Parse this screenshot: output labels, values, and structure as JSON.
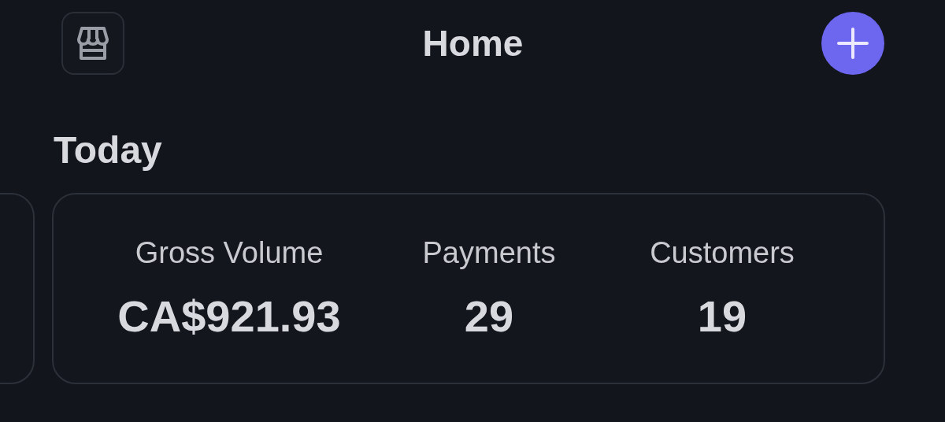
{
  "header": {
    "title": "Home"
  },
  "section": {
    "title": "Today"
  },
  "stats": [
    {
      "label": "Gross Volume",
      "value": "CA$921.93"
    },
    {
      "label": "Payments",
      "value": "29"
    },
    {
      "label": "Customers",
      "value": "19"
    }
  ]
}
